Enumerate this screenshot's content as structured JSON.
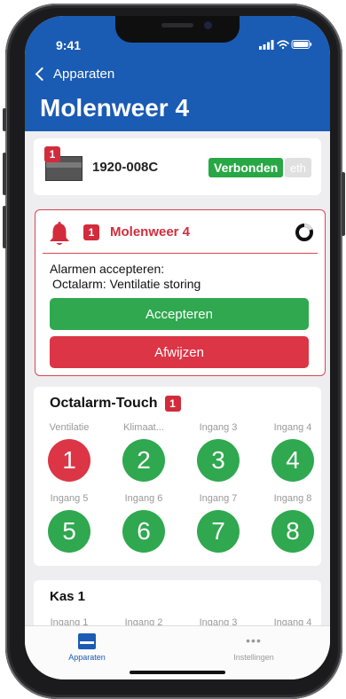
{
  "status_bar": {
    "time": "9:41"
  },
  "nav": {
    "back_label": "Apparaten",
    "title": "Molenweer 4"
  },
  "device": {
    "badge": "1",
    "name": "1920-008C",
    "status": "Verbonden",
    "connection": "eth"
  },
  "alarm": {
    "badge": "1",
    "title": "Molenweer 4",
    "message_line1": "Alarmen accepteren:",
    "message_line2": "Octalarm: Ventilatie storing",
    "accept_label": "Accepteren",
    "reject_label": "Afwijzen"
  },
  "octalarm": {
    "title": "Octalarm-Touch",
    "badge": "1",
    "inputs": [
      {
        "label": "Ventilatie",
        "number": "1",
        "state": "alarm"
      },
      {
        "label": "Klimaat...",
        "number": "2",
        "state": "ok"
      },
      {
        "label": "Ingang 3",
        "number": "3",
        "state": "ok"
      },
      {
        "label": "Ingang 4",
        "number": "4",
        "state": "ok"
      },
      {
        "label": "Ingang 5",
        "number": "5",
        "state": "ok"
      },
      {
        "label": "Ingang 6",
        "number": "6",
        "state": "ok"
      },
      {
        "label": "Ingang 7",
        "number": "7",
        "state": "ok"
      },
      {
        "label": "Ingang 8",
        "number": "8",
        "state": "ok"
      }
    ]
  },
  "kas": {
    "title": "Kas 1",
    "inputs": [
      "Ingang 1",
      "Ingang 2",
      "Ingang 3",
      "Ingang 4"
    ]
  },
  "tabbar": {
    "tab1_label": "Apparaten",
    "tab2_label": "Instellingen"
  },
  "colors": {
    "brand_blue": "#1a5bb3",
    "alarm_red": "#dc3545",
    "ok_green": "#2fa84f"
  }
}
